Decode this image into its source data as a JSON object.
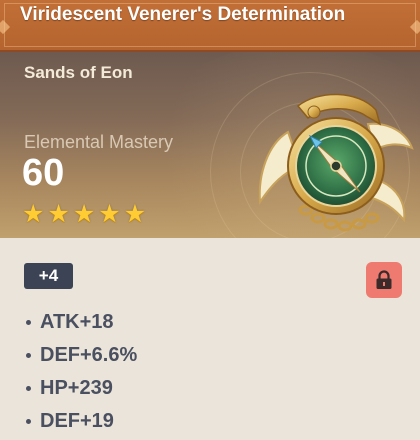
{
  "artifact": {
    "name": "Viridescent Venerer's Determination",
    "slot_type": "Sands of Eon",
    "main_stat": {
      "name": "Elemental Mastery",
      "value": "60"
    },
    "rarity_stars": 5,
    "level_label": "+4",
    "locked": true,
    "substats": [
      {
        "label": "ATK+18"
      },
      {
        "label": "DEF+6.6%"
      },
      {
        "label": "HP+239"
      },
      {
        "label": "DEF+19"
      }
    ]
  },
  "icons": {
    "star": "star-icon",
    "lock": "lock-icon",
    "artifact": "compass-artifact-icon"
  },
  "colors": {
    "title_bar": "#c26f37",
    "star": "#ffcc33",
    "level_badge": "#3b4354",
    "lock_button": "#ef7a6f",
    "substat_text": "#4a5060"
  }
}
